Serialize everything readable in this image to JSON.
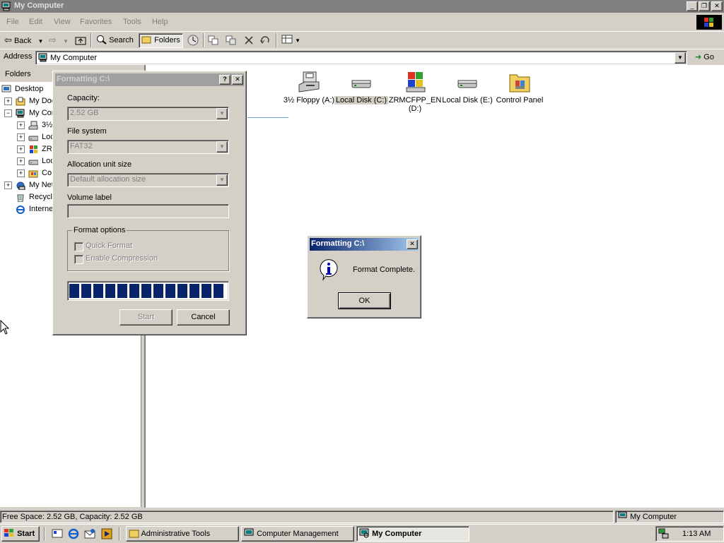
{
  "window": {
    "title": "My Computer",
    "caption_buttons": {
      "minimize": "_",
      "restore": "❐",
      "close": "✕"
    }
  },
  "menu": [
    "File",
    "Edit",
    "View",
    "Favorites",
    "Tools",
    "Help"
  ],
  "toolbar": {
    "back_label": "Back",
    "search_label": "Search",
    "folders_label": "Folders"
  },
  "address": {
    "label": "Address",
    "value": "My Computer",
    "go_label": "Go"
  },
  "folders_pane": {
    "header": "Folders",
    "items": [
      {
        "label": "Desktop",
        "icon": "desktop-icon",
        "level": 0
      },
      {
        "label": "My Doc",
        "icon": "my-documents-icon",
        "level": 1,
        "expander": "+"
      },
      {
        "label": "My Cor",
        "icon": "my-computer-icon",
        "level": 1,
        "expander": "−"
      },
      {
        "label": "3½",
        "icon": "floppy-icon",
        "level": 2,
        "expander": "+"
      },
      {
        "label": "Loc",
        "icon": "drive-icon",
        "level": 2,
        "expander": "+"
      },
      {
        "label": "ZR",
        "icon": "cd-icon",
        "level": 2,
        "expander": "+"
      },
      {
        "label": "Loc",
        "icon": "drive-icon",
        "level": 2,
        "expander": "+"
      },
      {
        "label": "Co",
        "icon": "control-panel-icon",
        "level": 2,
        "expander": "+"
      },
      {
        "label": "My Net",
        "icon": "network-icon",
        "level": 1,
        "expander": "+"
      },
      {
        "label": "Recycle",
        "icon": "recycle-bin-icon",
        "level": 1
      },
      {
        "label": "Interne",
        "icon": "internet-explorer-icon",
        "level": 1
      }
    ]
  },
  "drives": [
    {
      "label": "3½ Floppy (A:)",
      "icon": "floppy-drive-icon",
      "selected": false
    },
    {
      "label": "Local Disk (C:)",
      "icon": "hard-disk-icon",
      "selected": true
    },
    {
      "label": "ZRMCFPP_EN (D:)",
      "icon": "cd-drive-icon",
      "selected": false
    },
    {
      "label": "Local Disk (E:)",
      "icon": "hard-disk-icon",
      "selected": false
    },
    {
      "label": "Control Panel",
      "icon": "control-panel-folder-icon",
      "selected": false
    }
  ],
  "format_dialog": {
    "title": "Formatting C:\\",
    "help_btn": "?",
    "close_btn": "✕",
    "capacity_label": "Capacity:",
    "capacity_value": "2.52 GB",
    "filesystem_label": "File system",
    "filesystem_value": "FAT32",
    "allocation_label": "Allocation unit size",
    "allocation_value": "Default allocation size",
    "volume_label_label": "Volume label",
    "volume_label_value": "",
    "options_label": "Format options",
    "quick_format_label": "Quick Format",
    "compression_label": "Enable Compression",
    "progress_fraction": 1.0,
    "start_label": "Start",
    "cancel_label": "Cancel"
  },
  "message_box": {
    "title": "Formatting C:\\",
    "close_btn": "✕",
    "message": "Format Complete.",
    "icon": "information-icon",
    "ok_label": "OK"
  },
  "status_bar": {
    "left_text": "Free Space: 2.52 GB, Capacity: 2.52 GB",
    "right_text": "My Computer"
  },
  "taskbar": {
    "start_label": "Start",
    "tasks": [
      {
        "label": "Administrative Tools",
        "active": false
      },
      {
        "label": "Computer Management",
        "active": false
      },
      {
        "label": "My Computer",
        "active": true
      }
    ],
    "clock": "1:13 AM"
  },
  "colors": {
    "face": "#d4d0c8",
    "active_title_start": "#0a246a",
    "active_title_end": "#a6caf0",
    "inactive_title": "#808080",
    "progress": "#0a246a"
  }
}
